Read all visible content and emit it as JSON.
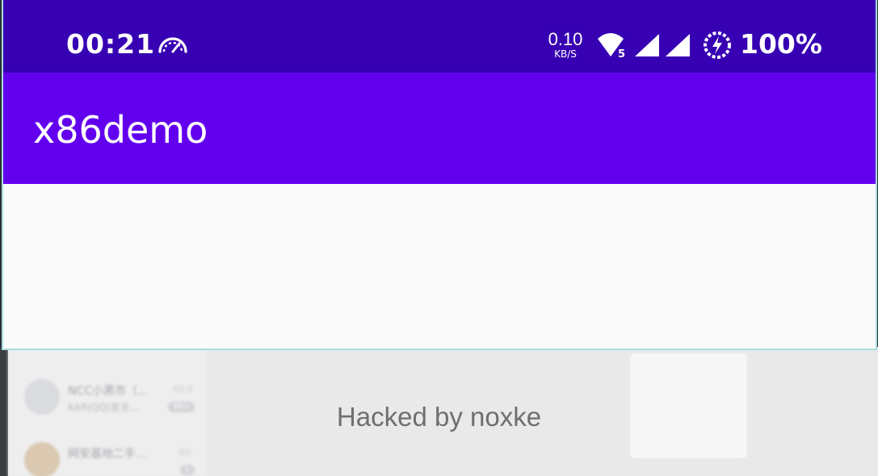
{
  "status_bar": {
    "time": "00:21",
    "net_speed_value": "0.10",
    "net_speed_unit": "KB/S",
    "wifi_badge": "5",
    "battery": "100%",
    "icons": [
      "speedometer-icon",
      "wifi-icon",
      "signal-icon",
      "signal-icon",
      "battery-saver-icon"
    ]
  },
  "app_bar": {
    "title": "x86demo"
  },
  "overlay": {
    "message": "Hacked by noxke"
  },
  "background_chats": [
    {
      "name": "NCC小黑市（...",
      "snippet": "KAR(QQ)发言...",
      "time": "00:0",
      "count": "99+"
    },
    {
      "name": "网安基地二手...",
      "snippet": "",
      "time": "00:",
      "count": "1"
    }
  ],
  "colors": {
    "status_bar": "#3700b3",
    "app_bar": "#6200ee",
    "content": "#fafafa",
    "background": "#e9e9ea",
    "message_text": "#6f6f70"
  }
}
